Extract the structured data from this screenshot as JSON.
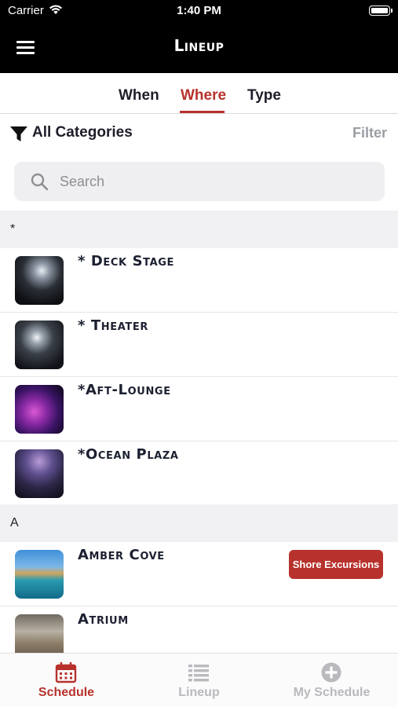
{
  "status_bar": {
    "carrier": "Carrier",
    "time": "1:40 PM"
  },
  "nav": {
    "title": "Lineup"
  },
  "tabs": [
    {
      "label": "When",
      "active": false
    },
    {
      "label": "Where",
      "active": true
    },
    {
      "label": "Type",
      "active": false
    }
  ],
  "filter": {
    "category_label": "All Categories",
    "filter_button": "Filter"
  },
  "search": {
    "placeholder": "Search"
  },
  "sections": [
    {
      "header": "*",
      "venues": [
        {
          "name": "* Deck Stage",
          "thumb": "deck-stage-photo"
        },
        {
          "name": "* Theater",
          "thumb": "theater-photo"
        },
        {
          "name": "*Aft-Lounge",
          "thumb": "aft-lounge-photo"
        },
        {
          "name": "*Ocean Plaza",
          "thumb": "ocean-plaza-photo"
        }
      ]
    },
    {
      "header": "A",
      "venues": [
        {
          "name": "Amber Cove",
          "thumb": "amber-cove-photo",
          "action": "Shore Excursions"
        },
        {
          "name": "Atrium",
          "thumb": "atrium-photo"
        }
      ]
    }
  ],
  "tab_bar": [
    {
      "label": "Schedule",
      "icon": "calendar-icon",
      "active": true
    },
    {
      "label": "Lineup",
      "icon": "list-icon",
      "active": false
    },
    {
      "label": "My Schedule",
      "icon": "plus-circle-icon",
      "active": false
    }
  ],
  "colors": {
    "accent": "#b7322c",
    "header_bg": "#000000",
    "inactive": "#b9b9be",
    "section_bg": "#f1f1f3"
  }
}
